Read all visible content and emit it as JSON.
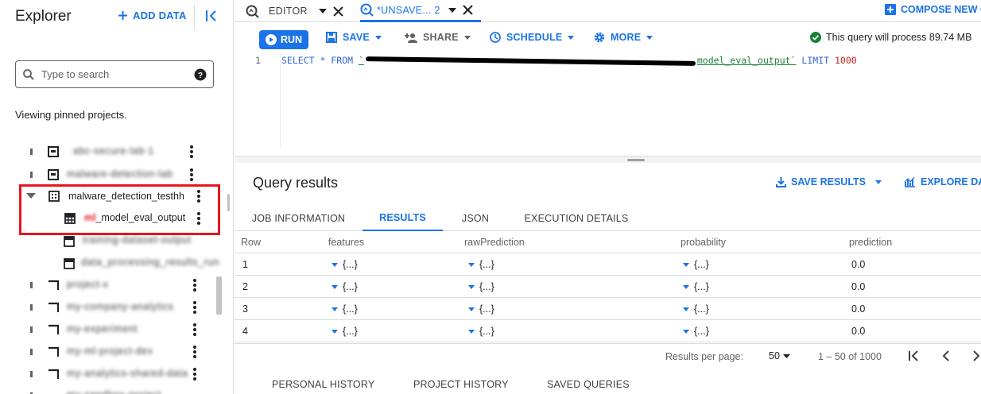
{
  "sidebar": {
    "title": "Explorer",
    "add_data": "ADD DATA",
    "search": {
      "placeholder": "Type to search",
      "value": ""
    },
    "pinned_note": "Viewing pinned projects.",
    "tree": [
      {
        "label": "abc-secure-lab-1",
        "type": "project",
        "redacted": true
      },
      {
        "label": "malware-detection-lab",
        "type": "project",
        "redacted": true
      },
      {
        "label": "malware_detection_testhh",
        "type": "dataset",
        "redacted": false
      },
      {
        "label": "_model_eval_output",
        "type": "table",
        "redacted": false,
        "prefix_redacted": "ml"
      },
      {
        "label": "training-dataset-output",
        "type": "table",
        "redacted": true
      },
      {
        "label": "data_processing_results_run",
        "type": "table",
        "redacted": true
      },
      {
        "label": "project-x",
        "type": "project",
        "redacted": true
      },
      {
        "label": "my-company-analytics",
        "type": "project",
        "redacted": true
      },
      {
        "label": "my-experiment",
        "type": "project",
        "redacted": true
      },
      {
        "label": "my-ml-project-dev",
        "type": "project",
        "redacted": true
      },
      {
        "label": "my-analytics-shared-data",
        "type": "project",
        "redacted": true
      },
      {
        "label": "my-sandbox-project",
        "type": "project",
        "redacted": true
      }
    ]
  },
  "tabs": {
    "editor": "EDITOR",
    "unsaved": "*UNSAVE... 2",
    "compose": "COMPOSE NEW Q"
  },
  "toolbar": {
    "run": "RUN",
    "save": "SAVE",
    "share": "SHARE",
    "schedule": "SCHEDULE",
    "more": "MORE",
    "status": "This query will process 89.74 MB"
  },
  "editor": {
    "line_number": "1",
    "kw_select": "SELECT * FROM ",
    "table_prefix": "`",
    "table_suffix": "model_eval_output`",
    "kw_limit": " LIMIT ",
    "limit": "1000"
  },
  "results": {
    "title": "Query results",
    "save_results": "SAVE RESULTS",
    "explore": "EXPLORE DATA",
    "tabs": [
      "JOB INFORMATION",
      "RESULTS",
      "JSON",
      "EXECUTION DETAILS"
    ],
    "active_tab": "RESULTS",
    "columns": [
      "Row",
      "features",
      "rawPrediction",
      "probability",
      "prediction"
    ],
    "rows": [
      [
        "1",
        "{...}",
        "{...}",
        "{...}",
        "0.0"
      ],
      [
        "2",
        "{...}",
        "{...}",
        "{...}",
        "0.0"
      ],
      [
        "3",
        "{...}",
        "{...}",
        "{...}",
        "0.0"
      ],
      [
        "4",
        "{...}",
        "{...}",
        "{...}",
        "0.0"
      ]
    ],
    "pagination": {
      "label": "Results per page:",
      "per_page": "50",
      "range": "1 – 50 of 1000"
    }
  },
  "history": [
    "PERSONAL HISTORY",
    "PROJECT HISTORY",
    "SAVED QUERIES"
  ],
  "colors": {
    "accent": "#1a73e8",
    "highlight": "#e8151e",
    "status_ok": "#188038"
  }
}
